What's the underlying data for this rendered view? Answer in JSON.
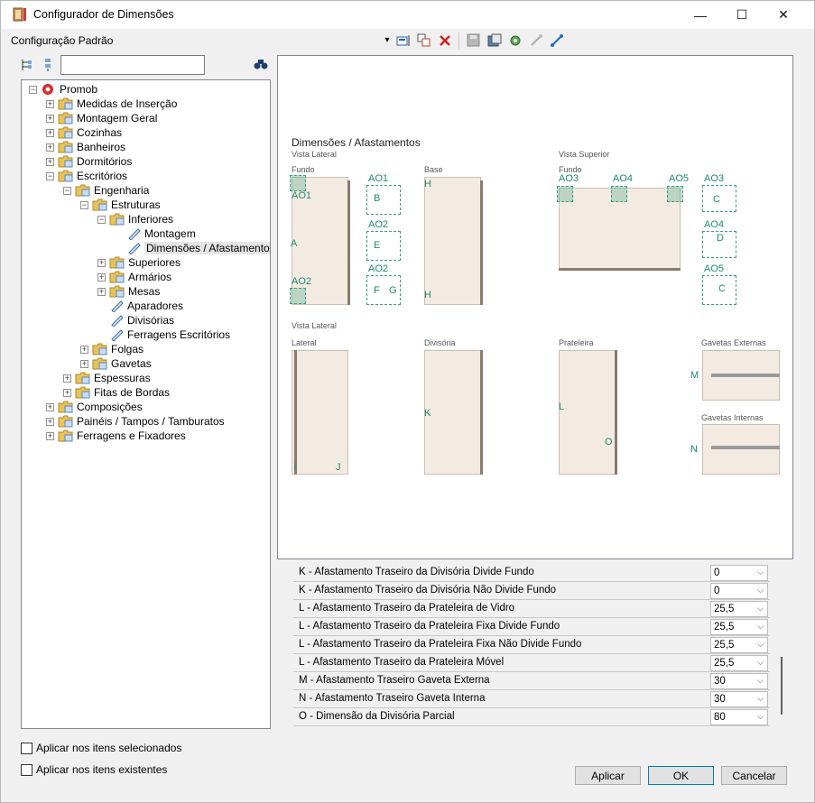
{
  "window": {
    "title": "Configurador de Dimensões",
    "min_glyph": "—",
    "max_glyph": "☐",
    "close_glyph": "✕"
  },
  "toolbar": {
    "config_label": "Configuração Padrão",
    "dropdown_glyph": "▾",
    "icons": [
      "new-icon",
      "copy-icon",
      "delete-icon",
      "save-icon",
      "save-as-icon",
      "settings-icon",
      "link-icon",
      "expand-icon"
    ]
  },
  "tree_search": {
    "value": "",
    "placeholder": ""
  },
  "tree": [
    {
      "label": "Promob",
      "level": 0,
      "expander": "−",
      "icon": "promob"
    },
    {
      "label": "Medidas de Inserção",
      "level": 1,
      "expander": "+",
      "icon": "folder"
    },
    {
      "label": "Montagem Geral",
      "level": 1,
      "expander": "+",
      "icon": "folder"
    },
    {
      "label": "Cozinhas",
      "level": 1,
      "expander": "+",
      "icon": "folder"
    },
    {
      "label": "Banheiros",
      "level": 1,
      "expander": "+",
      "icon": "folder"
    },
    {
      "label": "Dormitórios",
      "level": 1,
      "expander": "+",
      "icon": "folder"
    },
    {
      "label": "Escritórios",
      "level": 1,
      "expander": "−",
      "icon": "folder"
    },
    {
      "label": "Engenharia",
      "level": 2,
      "expander": "−",
      "icon": "folder"
    },
    {
      "label": "Estruturas",
      "level": 3,
      "expander": "−",
      "icon": "folder"
    },
    {
      "label": "Inferiores",
      "level": 4,
      "expander": "−",
      "icon": "folder"
    },
    {
      "label": "Montagem",
      "level": 5,
      "expander": "",
      "icon": "item"
    },
    {
      "label": "Dimensões / Afastamentos",
      "level": 5,
      "expander": "",
      "icon": "item",
      "selected": true
    },
    {
      "label": "Superiores",
      "level": 4,
      "expander": "+",
      "icon": "folder"
    },
    {
      "label": "Armários",
      "level": 4,
      "expander": "+",
      "icon": "folder"
    },
    {
      "label": "Mesas",
      "level": 4,
      "expander": "+",
      "icon": "folder"
    },
    {
      "label": "Aparadores",
      "level": 4,
      "expander": "",
      "icon": "item"
    },
    {
      "label": "Divisórias",
      "level": 4,
      "expander": "",
      "icon": "item"
    },
    {
      "label": "Ferragens Escritórios",
      "level": 4,
      "expander": "",
      "icon": "item"
    },
    {
      "label": "Folgas",
      "level": 3,
      "expander": "+",
      "icon": "folder"
    },
    {
      "label": "Gavetas",
      "level": 3,
      "expander": "+",
      "icon": "folder"
    },
    {
      "label": "Espessuras",
      "level": 2,
      "expander": "+",
      "icon": "folder"
    },
    {
      "label": "Fitas de Bordas",
      "level": 2,
      "expander": "+",
      "icon": "folder"
    },
    {
      "label": "Composições",
      "level": 1,
      "expander": "+",
      "icon": "folder"
    },
    {
      "label": "Painéis / Tampos / Tamburatos",
      "level": 1,
      "expander": "+",
      "icon": "folder"
    },
    {
      "label": "Ferragens e Fixadores",
      "level": 1,
      "expander": "+",
      "icon": "folder"
    }
  ],
  "drawing": {
    "title": "Dimensões / Afastamentos",
    "vista_lateral_1": "Vista Lateral",
    "vista_superior": "Vista Superior",
    "vista_lateral_2": "Vista Lateral",
    "fundo_1": "Fundo",
    "base": "Base",
    "fundo_2": "Fundo",
    "lateral": "Lateral",
    "divisoria": "Divisória",
    "prateleira": "Prateleira",
    "gavetas_externas": "Gavetas Externas",
    "gavetas_internas": "Gavetas Internas",
    "marks": {
      "AO1_top": "AO1",
      "AO1_side": "AO1",
      "A": "A",
      "AO2_side": "AO2",
      "AO2_a": "AO2",
      "AO2_b": "AO2",
      "B": "B",
      "E": "E",
      "F": "F",
      "G": "G",
      "H_top": "H",
      "H_bottom": "H",
      "AO3_left": "AO3",
      "AO4_top": "AO4",
      "AO5_top": "AO5",
      "AO3_right": "AO3",
      "AO4_right": "AO4",
      "AO5_right": "AO5",
      "C_1": "C",
      "D": "D",
      "C_2": "C",
      "I": "I",
      "J": "J",
      "K": "K",
      "L": "L",
      "O": "O",
      "M": "M",
      "N": "N"
    }
  },
  "properties": [
    {
      "label": "K - Afastamento Traseiro da Divisória Divide Fundo",
      "value": "0"
    },
    {
      "label": "K - Afastamento Traseiro da Divisória Não Divide Fundo",
      "value": "0"
    },
    {
      "label": "L - Afastamento Traseiro da Prateleira de Vidro",
      "value": "25,5"
    },
    {
      "label": "L - Afastamento Traseiro da Prateleira Fixa Divide Fundo",
      "value": "25,5"
    },
    {
      "label": "L - Afastamento Traseiro da Prateleira Fixa Não Divide Fundo",
      "value": "25,5"
    },
    {
      "label": "L - Afastamento Traseiro da Prateleira Móvel",
      "value": "25,5"
    },
    {
      "label": "M - Afastamento Traseiro Gaveta Externa",
      "value": "30"
    },
    {
      "label": "N - Afastamento Traseiro Gaveta Interna",
      "value": "30"
    },
    {
      "label": "O - Dimensão da Divisória Parcial",
      "value": "80"
    }
  ],
  "options": {
    "apply_selected": "Aplicar nos itens selecionados",
    "apply_existing": "Aplicar nos itens existentes"
  },
  "buttons": {
    "apply": "Aplicar",
    "ok": "OK",
    "cancel": "Cancelar"
  },
  "colors": {
    "accent": "#0078d7",
    "highlight_green": "#1e8a6e",
    "panel_fill": "#f3ebe2",
    "folder_yellow": "#e8c35a"
  }
}
